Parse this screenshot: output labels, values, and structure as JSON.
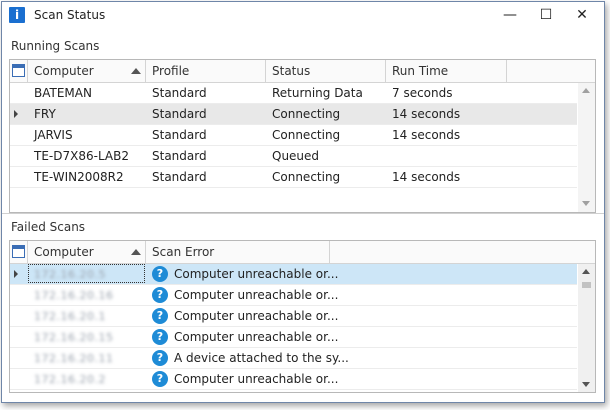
{
  "window": {
    "title": "Scan Status",
    "minimize": "—",
    "maximize": "☐",
    "close": "✕",
    "app_icon": "i"
  },
  "running": {
    "label": "Running Scans",
    "columns": [
      "Computer",
      "Profile",
      "Status",
      "Run Time"
    ],
    "rows": [
      {
        "computer": "BATEMAN",
        "profile": "Standard",
        "status": "Returning Data",
        "runtime": "7 seconds"
      },
      {
        "computer": "FRY",
        "profile": "Standard",
        "status": "Connecting",
        "runtime": "14 seconds"
      },
      {
        "computer": "JARVIS",
        "profile": "Standard",
        "status": "Connecting",
        "runtime": "14 seconds"
      },
      {
        "computer": "TE-D7X86-LAB2",
        "profile": "Standard",
        "status": "Queued",
        "runtime": ""
      },
      {
        "computer": "TE-WIN2008R2",
        "profile": "Standard",
        "status": "Connecting",
        "runtime": "14 seconds"
      }
    ]
  },
  "failed": {
    "label": "Failed Scans",
    "columns": [
      "Computer",
      "Scan Error"
    ],
    "rows": [
      {
        "computer": "172.16.20.5",
        "error": "Computer unreachable or..."
      },
      {
        "computer": "172.16.20.16",
        "error": "Computer unreachable or..."
      },
      {
        "computer": "172.16.20.1",
        "error": "Computer unreachable or..."
      },
      {
        "computer": "172.16.20.15",
        "error": "Computer unreachable or..."
      },
      {
        "computer": "172.16.20.11",
        "error": "A device attached to the sy..."
      },
      {
        "computer": "172.16.20.2",
        "error": "Computer unreachable or..."
      }
    ]
  },
  "icons": {
    "table": "table-icon",
    "question": "question-icon",
    "sort": "sort-ascending-icon"
  },
  "colors": {
    "selection": "#cde6f7",
    "highlight_row": "#e8e8e8",
    "question_icon": "#1e8bd6",
    "app_icon": "#1a6fd0"
  }
}
